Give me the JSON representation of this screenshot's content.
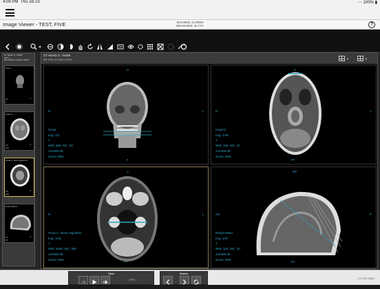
{
  "status": {
    "time": "4:09 PM",
    "date": "Thu Jul 23",
    "battery": "100%"
  },
  "window": {
    "title": "Image Viewer - TEST, FIVE",
    "patient_name": "MAURER, ALFRED",
    "patient_id": "000-00-0020, 30 YTT"
  },
  "toolbar": {
    "tools": [
      "back-icon",
      "cine-icon",
      "zoom-icon",
      "window-level-icon",
      "contrast-icon",
      "invert-icon",
      "pan-icon",
      "rotate-icon",
      "flip-icon",
      "annotate-icon",
      "measure-icon",
      "eye-icon",
      "settings-icon",
      "grid-icon",
      "layout-icon",
      "crosshair-icon",
      "pencil-icon",
      "reset-icon"
    ]
  },
  "series_panel": {
    "header": [
      "CT HEAD C- 76459",
      "2074",
      "MR 2008-12-19@14:39:00"
    ],
    "thumbnails": [
      {
        "label": "Scout",
        "footer": [
          "CT",
          "1"
        ],
        "num": "1"
      },
      {
        "label": "Head C-",
        "footer": [
          "CT",
          "146"
        ],
        "num": "2"
      },
      {
        "label": "Head C- Bone Algorithm",
        "footer": [
          "CT",
          "146"
        ],
        "num": "3"
      },
      {
        "label": "Reformatted",
        "footer": [
          "CT",
          "47"
        ],
        "num": "4"
      }
    ]
  },
  "viewer": {
    "header_title": "CT HEAD C- 76459",
    "header_sub": "MR 2008-12-19@14:39:00",
    "panes": [
      {
        "top": "H",
        "left": "R",
        "right": "L",
        "bottom": "F",
        "info": [
          "Scout",
          "Img: 1/2",
          "1",
          "WW: 500, WC: 50",
          "122408-39",
          "Zoom: 98%"
        ]
      },
      {
        "top": "A",
        "left": "R",
        "right": "L",
        "bottom": "PF",
        "info": [
          "Head C-",
          "Img: 1/46",
          "1",
          "WW: 100, WC: 40",
          "122408-39",
          "Zoom: 68%"
        ]
      },
      {
        "top": "A",
        "left": "R",
        "right": "L",
        "bottom": "PF",
        "info": [
          "Head C- Bone Algorithm",
          "Img: 1/46",
          "1",
          "WW: 2000, WC: 400",
          "122408-39",
          "Zoom: 68%"
        ]
      },
      {
        "top": "HP",
        "left": "AH",
        "right": "P",
        "bottom": "FA",
        "info": [
          "Reformatted",
          "Img: 1/47",
          "1",
          "WW: 100, WC: 40",
          "122408-39",
          "Zoom: 68%"
        ]
      }
    ]
  },
  "bottom": {
    "cine_label": "Cine",
    "series_label": "Series",
    "speed": "1 FPS",
    "version": "3.2.7901.29811"
  }
}
